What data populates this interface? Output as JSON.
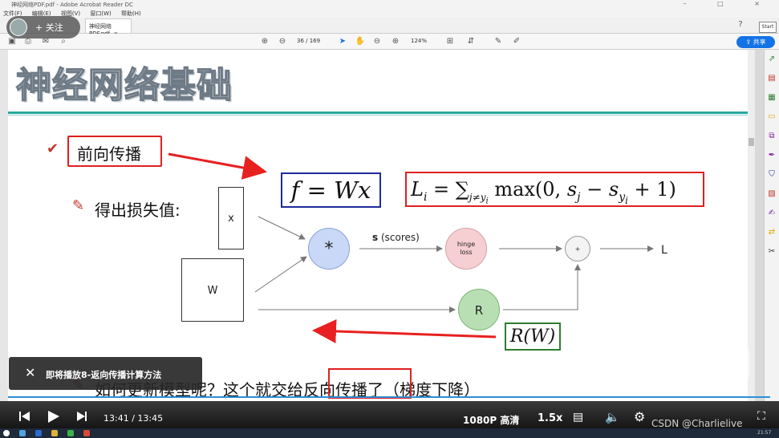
{
  "window": {
    "title": "神经网络PDF.pdf - Adobe Acrobat Reader DC",
    "controls": "–  □  ×"
  },
  "menu": [
    "文件(F)",
    "编辑(E)",
    "视图(V)",
    "窗口(W)",
    "帮助(H)"
  ],
  "tab": {
    "label": "神经网络PDF.pdf",
    "close": "×"
  },
  "follow": {
    "label": "+ 关注"
  },
  "start_badge": "Start",
  "toolbar": {
    "page": "36 / 169",
    "zoom": "124%",
    "share": "共享",
    "icons": [
      "save-icon",
      "print-icon",
      "email-icon",
      "search-icon",
      "page-up-icon",
      "page-down-icon",
      "select-icon",
      "hand-icon",
      "zoom-out-icon",
      "zoom-in-icon",
      "fit-icon",
      "scroll-icon",
      "comment-icon",
      "pen-icon",
      "help-icon",
      "bell-icon",
      "user-icon"
    ]
  },
  "slide": {
    "title": "神经网络基础",
    "forward": "前向传播",
    "derive": "得出损失值:",
    "update_q": "如何更新模型呢？这个就交给",
    "update_back": "反向传播",
    "update_tail": "了（梯度下降）",
    "f_eq": "f = Wx",
    "loss_eq": "L_i = ∑_{j≠y_i} max(0, s_j − s_{y_i} + 1)",
    "rw": "R(W)"
  },
  "diagram": {
    "x": "x",
    "w": "W",
    "mul": "*",
    "scores_bold": "s",
    "scores_rest": " (scores)",
    "hinge_1": "hinge",
    "hinge_2": "loss",
    "plus": "+",
    "r": "R",
    "l": "L"
  },
  "toast": {
    "close": "✕",
    "text": "即将播放8-返向传播计算方法"
  },
  "player": {
    "time": "13:41 / 13:45",
    "quality": "1080P 高清",
    "speed": "1.5x",
    "watermark": "CSDN @Charlielive",
    "progress": 0.995
  },
  "taskbar": {
    "clock": "21:57"
  },
  "colors": {
    "accent": "#1473e6",
    "teal": "#2aa7a0",
    "red": "#e02020",
    "blue_box": "#1e2a9a",
    "green_box": "#2e7d32"
  }
}
